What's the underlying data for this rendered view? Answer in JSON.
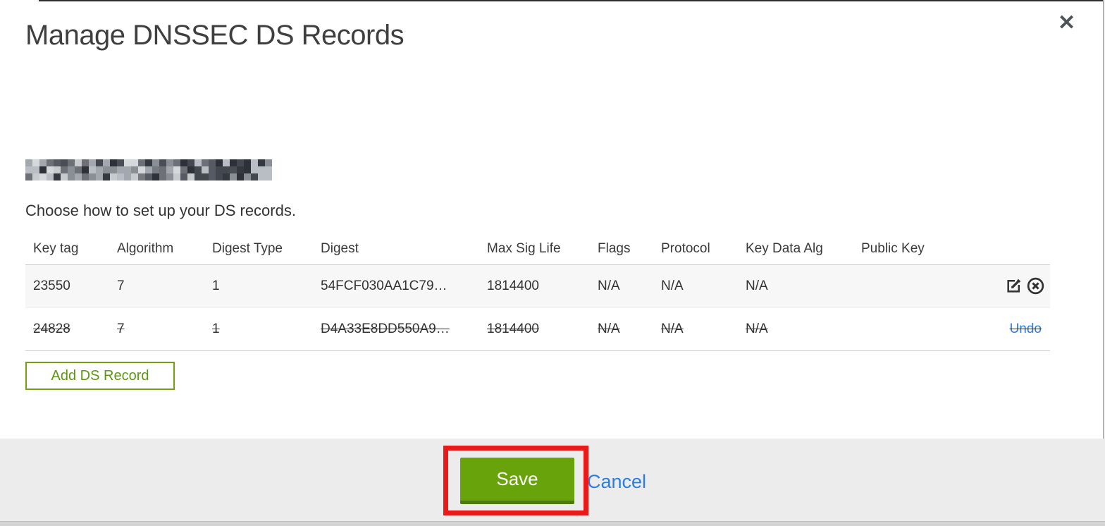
{
  "modal": {
    "title": "Manage DNSSEC DS Records",
    "close_icon": "✕",
    "domain": {
      "redacted": true
    },
    "subtitle": "Choose how to set up your DS records.",
    "table": {
      "headers": [
        "Key tag",
        "Algorithm",
        "Digest Type",
        "Digest",
        "Max Sig Life",
        "Flags",
        "Protocol",
        "Key Data Alg",
        "Public Key"
      ],
      "rows": [
        {
          "key_tag": "23550",
          "algorithm": "7",
          "digest_type": "1",
          "digest": "54FCF030AA1C79…",
          "max_sig_life": "1814400",
          "flags": "N/A",
          "protocol": "N/A",
          "key_data_alg": "N/A",
          "public_key": "",
          "state": "normal"
        },
        {
          "key_tag": "24828",
          "algorithm": "7",
          "digest_type": "1",
          "digest": "D4A33E8DD550A9…",
          "max_sig_life": "1814400",
          "flags": "N/A",
          "protocol": "N/A",
          "key_data_alg": "N/A",
          "public_key": "",
          "state": "deleted",
          "undo_label": "Undo"
        }
      ]
    },
    "add_button_label": "Add DS Record",
    "footer": {
      "save_label": "Save",
      "cancel_label": "Cancel"
    }
  },
  "colors": {
    "button_green": "#68a30c",
    "button_green_shadow": "#4e7a0e",
    "outline_green": "#71a011",
    "link_blue": "#2d7de3",
    "annotation_red": "#e81a1a",
    "footer_gray": "#ececec",
    "row_alt_gray": "#f7f7f7",
    "border_gray": "#cccccc"
  },
  "redacted_pixels": {
    "palette": [
      "#34383f",
      "#565b63",
      "#8a8f96",
      "#b9bec4",
      "#6d7077",
      "#2e3238",
      "#a3a8ae",
      "#d6d9dc",
      "#4b4f55",
      "#c8cbce",
      "#757a80",
      "#43474e"
    ]
  },
  "annotation_note": "red rectangle highlighting the Save button"
}
